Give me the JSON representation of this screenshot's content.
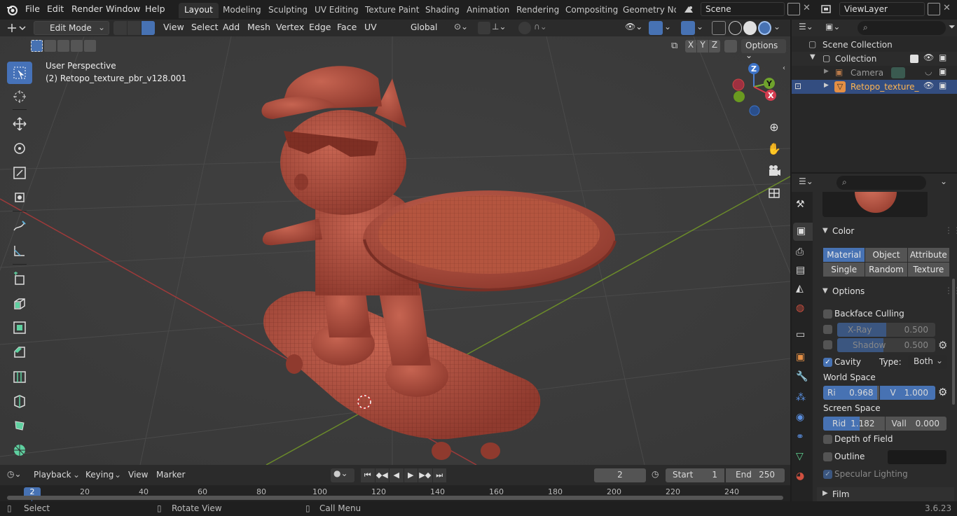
{
  "topbar": {
    "menus": [
      "File",
      "Edit",
      "Render",
      "Window",
      "Help"
    ],
    "workspaces": [
      "Layout",
      "Modeling",
      "Sculpting",
      "UV Editing",
      "Texture Paint",
      "Shading",
      "Animation",
      "Rendering",
      "Compositing",
      "Geometry Noc"
    ],
    "scene": "Scene",
    "view_layer": "ViewLayer"
  },
  "header": {
    "mode": "Edit Mode",
    "menus": [
      "View",
      "Select",
      "Add",
      "Mesh",
      "Vertex",
      "Edge",
      "Face",
      "UV"
    ],
    "orientation": "Global",
    "options": "Options",
    "axes": [
      "X",
      "Y",
      "Z"
    ]
  },
  "viewport": {
    "perspective": "User Perspective",
    "object_label": "(2) Retopo_texture_pbr_v128.001",
    "mesh_color": "#a5493c"
  },
  "gizmo": {
    "z": "Z",
    "y": "Y",
    "x": "X"
  },
  "outliner": {
    "scene_collection": "Scene Collection",
    "collection": "Collection",
    "camera": "Camera",
    "object": "Retopo_texture_"
  },
  "props": {
    "color_panel": "Color",
    "color_options": [
      "Material",
      "Object",
      "Attribute",
      "Single",
      "Random",
      "Texture"
    ],
    "options_panel": "Options",
    "backface": "Backface Culling",
    "xray": "X-Ray",
    "xray_val": "0.500",
    "shadow": "Shadow",
    "shadow_val": "0.500",
    "cavity": "Cavity",
    "type_label": "Type:",
    "type_val": "Both",
    "world_space": "World Space",
    "ws_r_label": "Ri",
    "ws_r": "0.968",
    "ws_v_label": "V",
    "ws_v": "1.000",
    "screen_space": "Screen Space",
    "ss_r_label": "Rid",
    "ss_r": "1.182",
    "ss_v_label": "Vall",
    "ss_v": "0.000",
    "dof": "Depth of Field",
    "outline": "Outline",
    "specular": "Specular Lighting",
    "film": "Film"
  },
  "timeline": {
    "menus": [
      "Playback",
      "Keying",
      "View",
      "Marker"
    ],
    "current_frame": "2",
    "start_label": "Start",
    "start": "1",
    "end_label": "End",
    "end": "250",
    "ticks": [
      "2",
      "20",
      "40",
      "60",
      "80",
      "100",
      "120",
      "140",
      "160",
      "180",
      "200",
      "220",
      "240"
    ]
  },
  "status": {
    "select": "Select",
    "rotate": "Rotate View",
    "call_menu": "Call Menu",
    "version": "3.6.23"
  }
}
